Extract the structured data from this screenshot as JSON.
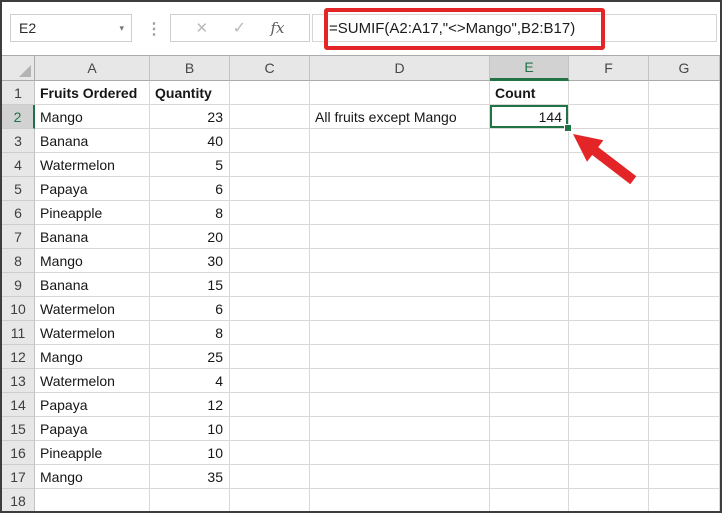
{
  "formula_bar": {
    "name_box_value": "E2",
    "dropdown_icon": "▾",
    "separator_dots_icon": "⋮",
    "cancel_icon": "✕",
    "enter_icon": "✓",
    "insert_function_icon": "fx",
    "formula": "=SUMIF(A2:A17,\"<>Mango\",B2:B17)"
  },
  "colors": {
    "selection_green": "#217346",
    "annotation_red": "#e42527",
    "header_bg": "#e7e7e7",
    "selected_header_bg": "#d2d2d2",
    "gridline": "#d8d8d8"
  },
  "sheet": {
    "column_headers": [
      "A",
      "B",
      "C",
      "D",
      "E",
      "F",
      "G"
    ],
    "selected_column": "E",
    "selected_row": "2",
    "selected_cell": "E2",
    "rows": [
      {
        "num": "1",
        "cells": {
          "A": "Fruits Ordered",
          "B": "Quantity",
          "E": "Count"
        }
      },
      {
        "num": "2",
        "cells": {
          "A": "Mango",
          "B": "23",
          "D": "All fruits except Mango",
          "E": "144"
        }
      },
      {
        "num": "3",
        "cells": {
          "A": "Banana",
          "B": "40"
        }
      },
      {
        "num": "4",
        "cells": {
          "A": "Watermelon",
          "B": "5"
        }
      },
      {
        "num": "5",
        "cells": {
          "A": "Papaya",
          "B": "6"
        }
      },
      {
        "num": "6",
        "cells": {
          "A": "Pineapple",
          "B": "8"
        }
      },
      {
        "num": "7",
        "cells": {
          "A": "Banana",
          "B": "20"
        }
      },
      {
        "num": "8",
        "cells": {
          "A": "Mango",
          "B": "30"
        }
      },
      {
        "num": "9",
        "cells": {
          "A": "Banana",
          "B": "15"
        }
      },
      {
        "num": "10",
        "cells": {
          "A": "Watermelon",
          "B": "6"
        }
      },
      {
        "num": "11",
        "cells": {
          "A": "Watermelon",
          "B": "8"
        }
      },
      {
        "num": "12",
        "cells": {
          "A": "Mango",
          "B": "25"
        }
      },
      {
        "num": "13",
        "cells": {
          "A": "Watermelon",
          "B": "4"
        }
      },
      {
        "num": "14",
        "cells": {
          "A": "Papaya",
          "B": "12"
        }
      },
      {
        "num": "15",
        "cells": {
          "A": "Papaya",
          "B": "10"
        }
      },
      {
        "num": "16",
        "cells": {
          "A": "Pineapple",
          "B": "10"
        }
      },
      {
        "num": "17",
        "cells": {
          "A": "Mango",
          "B": "35"
        }
      },
      {
        "num": "18",
        "cells": {}
      }
    ]
  }
}
